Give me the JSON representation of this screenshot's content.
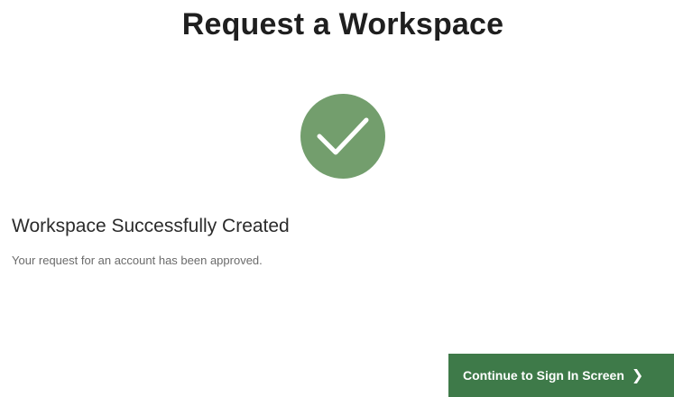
{
  "page": {
    "title": "Request a Workspace"
  },
  "success": {
    "icon": "checkmark-icon",
    "badge_color": "#739e6d",
    "heading": "Workspace Successfully Created",
    "message": "Your request for an account has been approved."
  },
  "actions": {
    "continue_label": "Continue to Sign In Screen",
    "continue_chevron": "❯",
    "continue_color": "#3e7a49"
  }
}
